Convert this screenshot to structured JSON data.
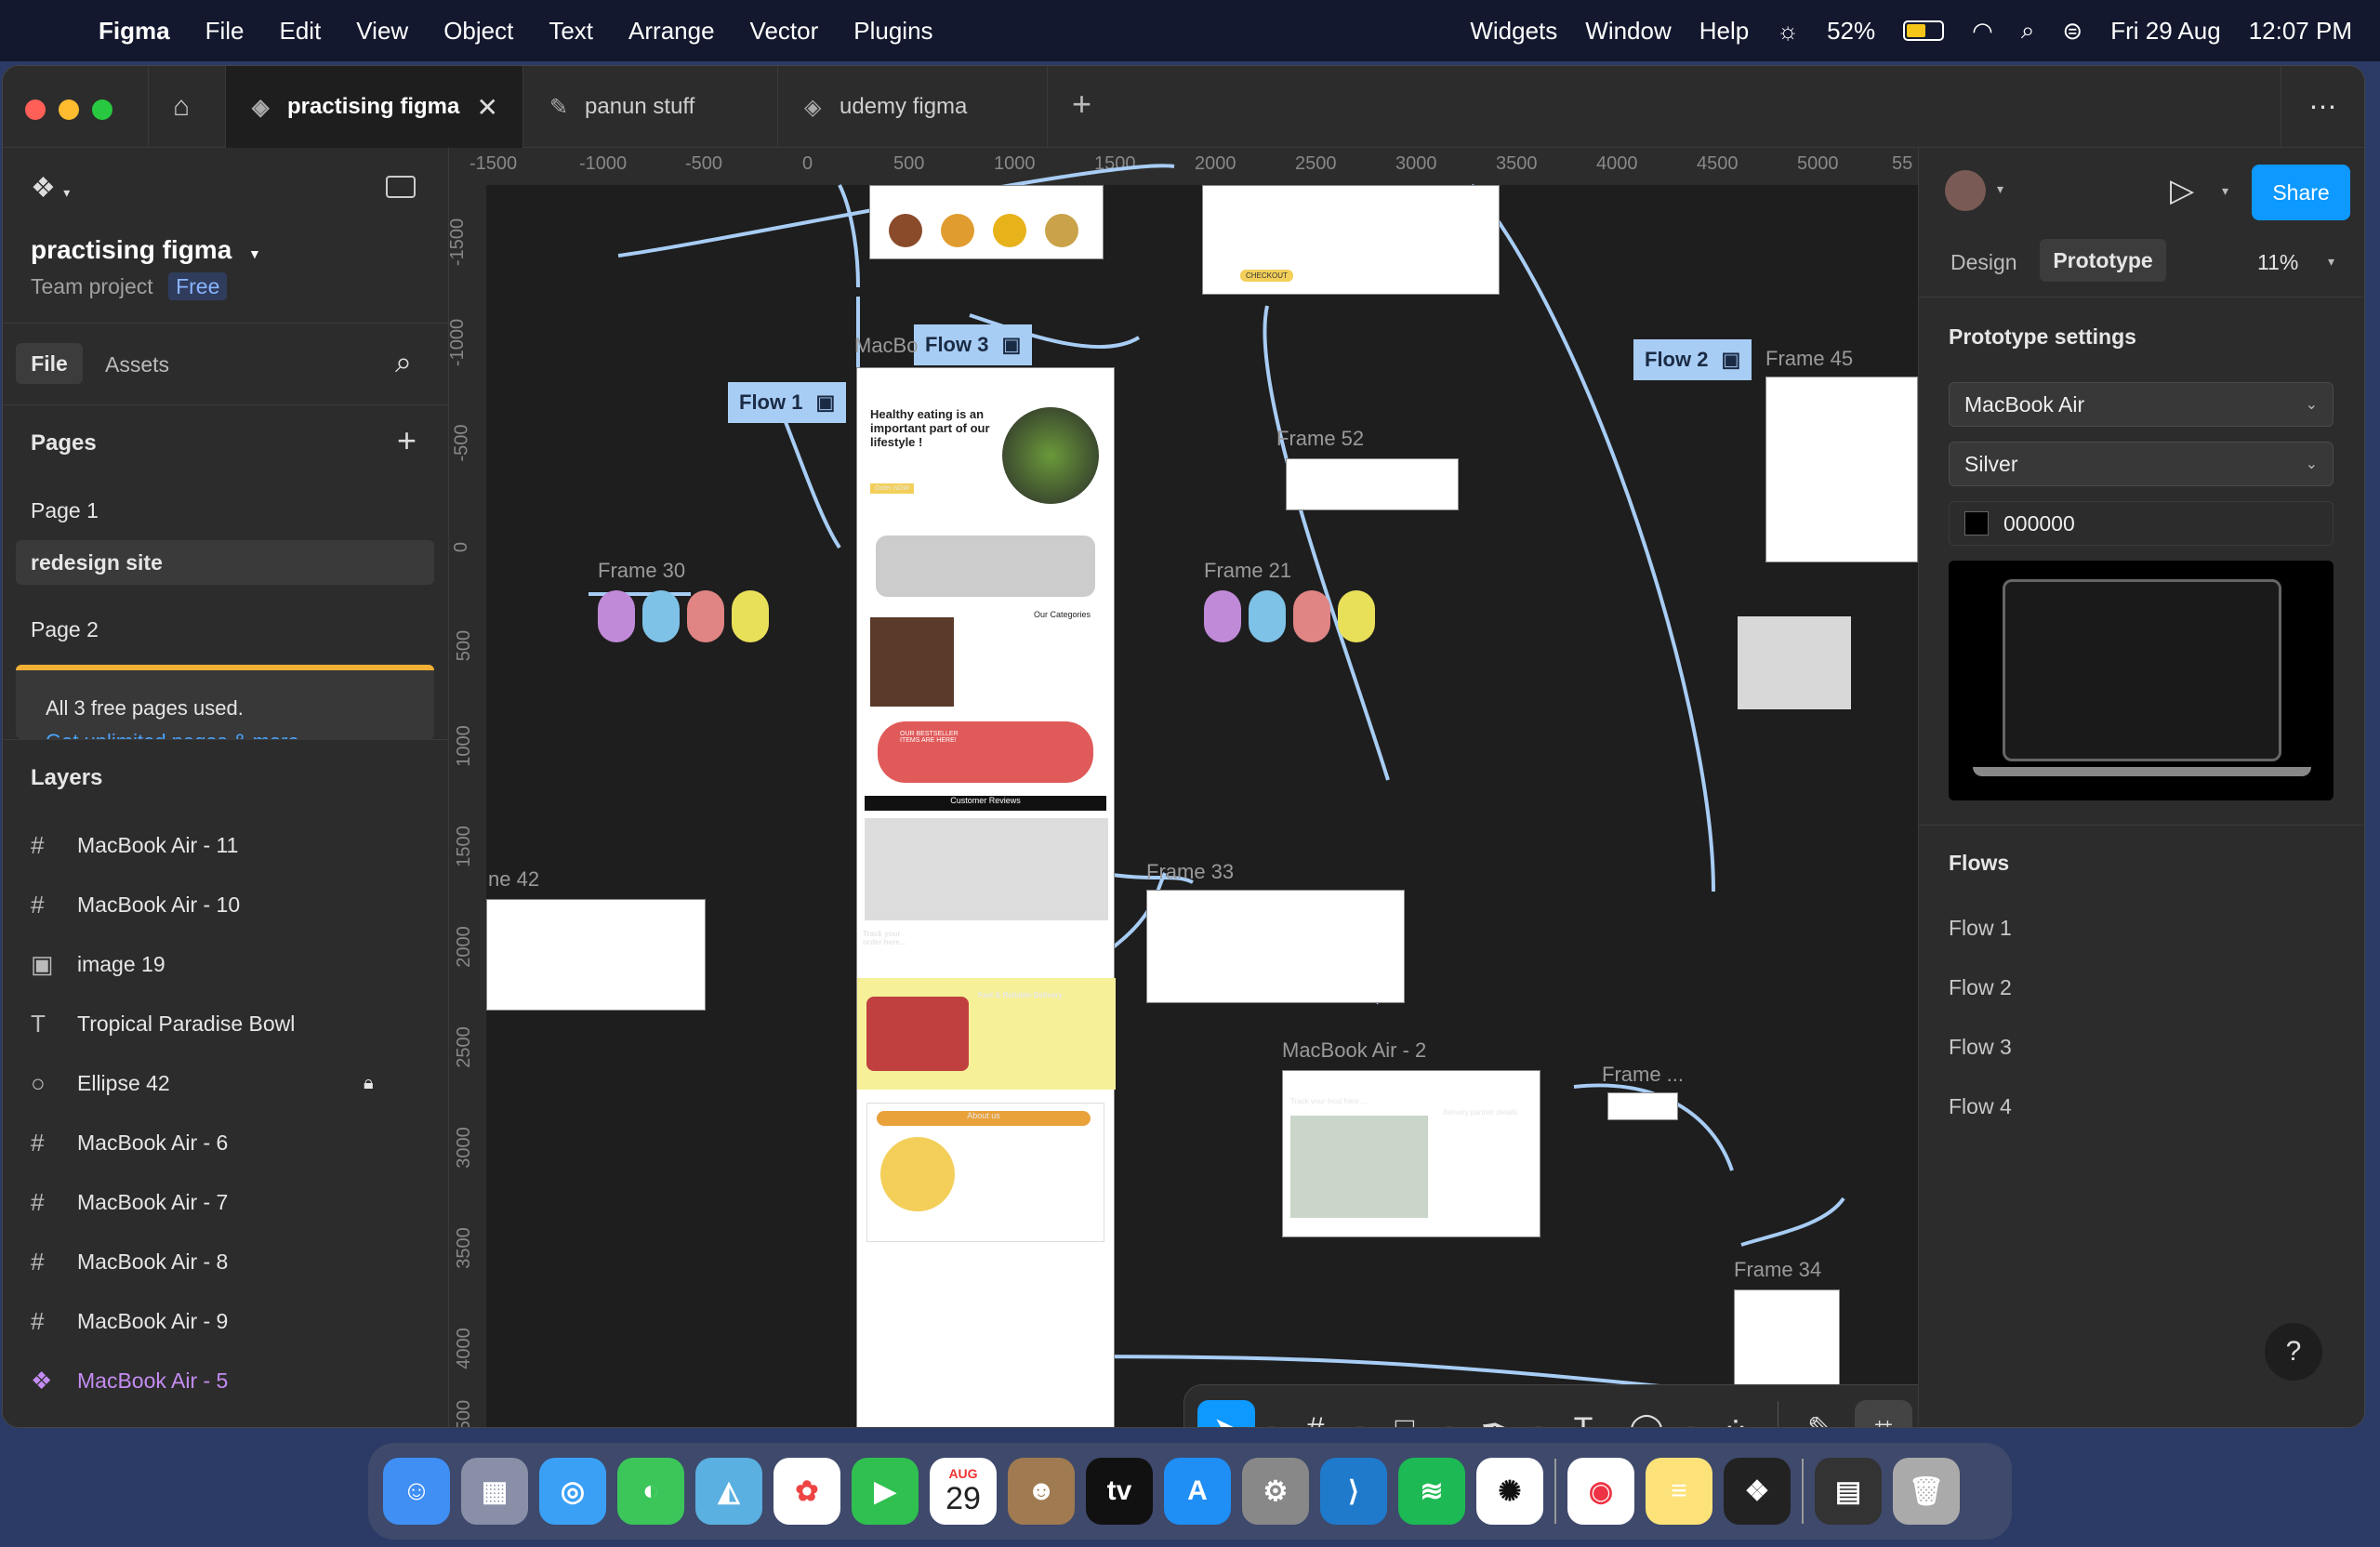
{
  "menubar": {
    "app": "Figma",
    "items": [
      "File",
      "Edit",
      "View",
      "Object",
      "Text",
      "Arrange",
      "Vector",
      "Plugins"
    ],
    "right_items": [
      "Widgets",
      "Window",
      "Help"
    ],
    "battery": "52%",
    "date": "Fri 29 Aug",
    "time": "12:07 PM"
  },
  "tabs": [
    {
      "label": "practising figma",
      "active": true
    },
    {
      "label": "panun stuff"
    },
    {
      "label": "udemy figma"
    }
  ],
  "file": {
    "name": "practising figma",
    "subtitle": "Team project",
    "plan": "Free",
    "tab_file": "File",
    "tab_assets": "Assets"
  },
  "pages": {
    "header": "Pages",
    "items": [
      "Page 1",
      "redesign site",
      "Page 2"
    ],
    "selected": "redesign site",
    "notice": "All 3 free pages used.",
    "notice_link": "Get unlimited pages & more"
  },
  "layers": {
    "header": "Layers",
    "items": [
      {
        "icon": "frame-icon",
        "label": "MacBook Air - 11"
      },
      {
        "icon": "frame-icon",
        "label": "MacBook Air - 10"
      },
      {
        "icon": "image-icon",
        "label": "image 19"
      },
      {
        "icon": "text-icon",
        "label": "Tropical Paradise Bowl"
      },
      {
        "icon": "ellipse-icon",
        "label": "Ellipse 42",
        "locked": true
      },
      {
        "icon": "frame-icon",
        "label": "MacBook Air - 6"
      },
      {
        "icon": "frame-icon",
        "label": "MacBook Air - 7"
      },
      {
        "icon": "frame-icon",
        "label": "MacBook Air - 8"
      },
      {
        "icon": "frame-icon",
        "label": "MacBook Air - 9"
      },
      {
        "icon": "component-icon",
        "label": "MacBook Air - 5",
        "highlight": true
      }
    ]
  },
  "ruler": {
    "top": [
      "-1500",
      "-1000",
      "-500",
      "0",
      "500",
      "1000",
      "1500",
      "2000",
      "2500",
      "3000",
      "3500",
      "4000",
      "4500",
      "5000",
      "55"
    ],
    "left": [
      "-1500",
      "-1000",
      "-500",
      "0",
      "500",
      "1000",
      "1500",
      "2000",
      "2500",
      "3000",
      "3500",
      "4000",
      "500"
    ]
  },
  "canvas": {
    "frames": [
      "Frame 30",
      "Frame 21",
      "Frame 52",
      "Frame 45",
      "Frame 33",
      "Frame 34",
      "MacBook Air - 2",
      "Frame ...",
      "MacBo",
      "ne 42"
    ],
    "flows": [
      "Flow 1",
      "Flow 2",
      "Flow 3"
    ],
    "site": {
      "hero": "Healthy eating is an important part of our lifestyle !",
      "order": "Order NOW",
      "categories": "Our Categories",
      "reviews": "Customer Reviews",
      "bestsellers": "OUR BESTSELLER ITEMS ARE HERE!",
      "track": "Track your order here...",
      "delivery_title": "Fast & Reliable Delivery",
      "about": "About us",
      "map_title": "Track your food here ....",
      "partner": "delivery partner details",
      "checkout": "CHECKOUT"
    }
  },
  "right": {
    "share": "Share",
    "tab_design": "Design",
    "tab_prototype": "Prototype",
    "zoom": "11%",
    "settings_title": "Prototype settings",
    "device": "MacBook Air",
    "color": "Silver",
    "bg_hex": "000000",
    "flows_title": "Flows",
    "flows": [
      "Flow 1",
      "Flow 2",
      "Flow 3",
      "Flow 4"
    ]
  },
  "toolbar": {
    "tools": [
      "move",
      "frame",
      "rectangle",
      "pen",
      "text",
      "comment",
      "components"
    ]
  },
  "dock": {
    "calendar_month": "AUG",
    "calendar_day": "29"
  }
}
